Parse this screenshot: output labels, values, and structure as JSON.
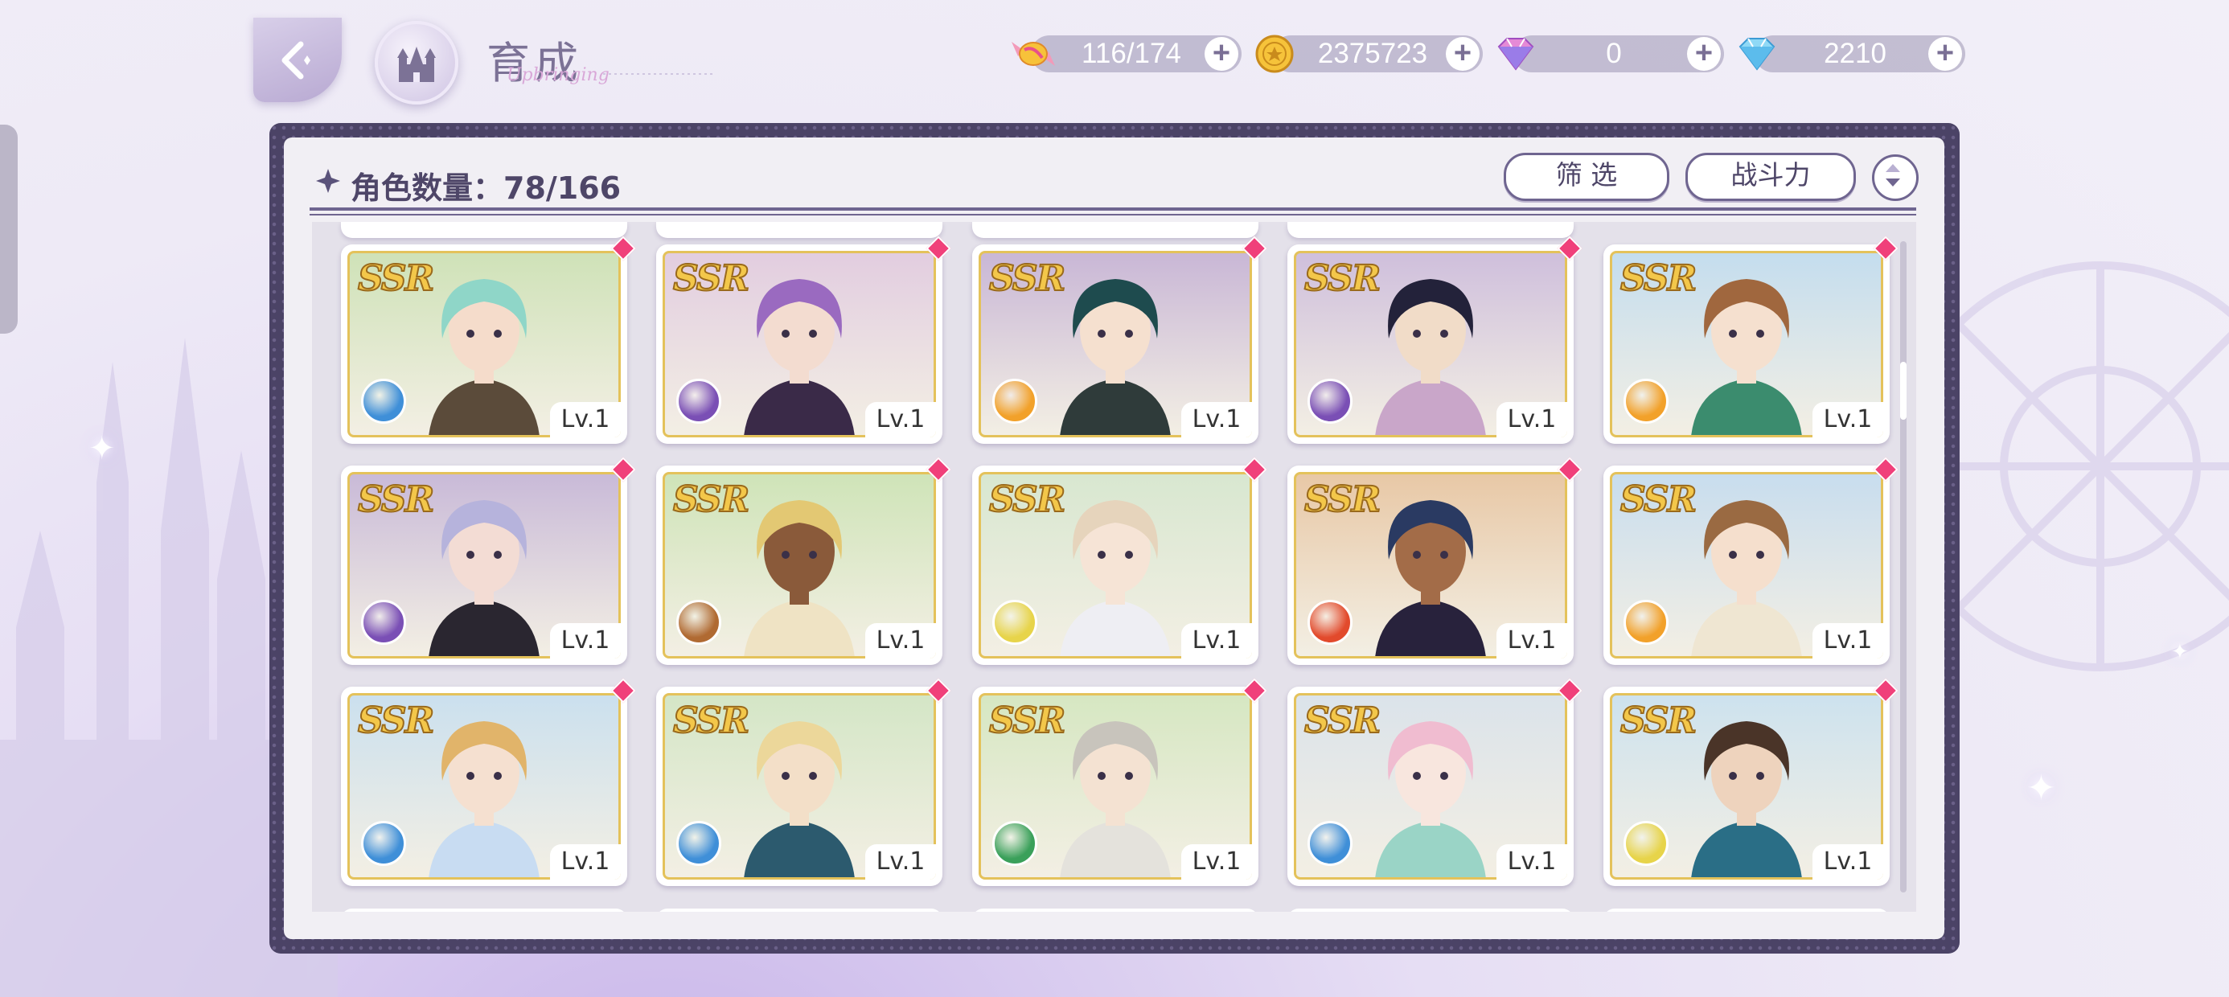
{
  "header": {
    "title": "育成",
    "title_script": "Upbringing"
  },
  "resources": [
    {
      "name": "candy-stamina",
      "value": "116/174",
      "icon": "candy-icon"
    },
    {
      "name": "gold-coin",
      "value": "2375723",
      "icon": "coin-icon"
    },
    {
      "name": "paid-gem",
      "value": "0",
      "icon": "pink-diamond-icon"
    },
    {
      "name": "free-gem",
      "value": "2210",
      "icon": "blue-diamond-icon"
    }
  ],
  "panel": {
    "count_label": "角色数量：78/166",
    "filter_label": "筛 选",
    "sort_label": "战斗力"
  },
  "cards": [
    {
      "rarity": "SSR",
      "level": "Lv.1",
      "attr_color": "#3f8fd8",
      "hair": "#8fd6c8",
      "bg": "#cfe2b8",
      "skin": "#f5dccb",
      "outfit": "#5b4b3a"
    },
    {
      "rarity": "SSR",
      "level": "Lv.1",
      "attr_color": "#7a4fb5",
      "hair": "#9a6ac0",
      "bg": "#e2cde0",
      "skin": "#f3dcd0",
      "outfit": "#3a2a48"
    },
    {
      "rarity": "SSR",
      "level": "Lv.1",
      "attr_color": "#f2a12a",
      "hair": "#1e4b4e",
      "bg": "#c9b7d6",
      "skin": "#f5e0cf",
      "outfit": "#2f3b3a"
    },
    {
      "rarity": "SSR",
      "level": "Lv.1",
      "attr_color": "#7a4fb5",
      "hair": "#23223a",
      "bg": "#cfbfdc",
      "skin": "#f1dcc8",
      "outfit": "#c9a6c9"
    },
    {
      "rarity": "SSR",
      "level": "Lv.1",
      "attr_color": "#f2a12a",
      "hair": "#a0673e",
      "bg": "#c4ddee",
      "skin": "#f5e0cf",
      "outfit": "#3b8c6e"
    },
    {
      "rarity": "SSR",
      "level": "Lv.1",
      "attr_color": "#7a4fb5",
      "hair": "#b6b3dc",
      "bg": "#c9bad8",
      "skin": "#f3dcd4",
      "outfit": "#2a2630"
    },
    {
      "rarity": "SSR",
      "level": "Lv.1",
      "attr_color": "#b06a32",
      "hair": "#e3c873",
      "bg": "#cfe4b8",
      "skin": "#8a5a3a",
      "outfit": "#efe3c4"
    },
    {
      "rarity": "SSR",
      "level": "Lv.1",
      "attr_color": "#e7d44a",
      "hair": "#e6d4bc",
      "bg": "#d8e7d0",
      "skin": "#f6e4d6",
      "outfit": "#eeeef3"
    },
    {
      "rarity": "SSR",
      "level": "Lv.1",
      "attr_color": "#e24a2c",
      "hair": "#2a3a62",
      "bg": "#e8c8a6",
      "skin": "#a36c48",
      "outfit": "#28223c"
    },
    {
      "rarity": "SSR",
      "level": "Lv.1",
      "attr_color": "#f2a12a",
      "hair": "#9a6a42",
      "bg": "#c8ddee",
      "skin": "#f5dfcd",
      "outfit": "#efe6d2"
    },
    {
      "rarity": "SSR",
      "level": "Lv.1",
      "attr_color": "#3f8fd8",
      "hair": "#e1b46a",
      "bg": "#cbe0ee",
      "skin": "#f5e0d0",
      "outfit": "#c8dcf2"
    },
    {
      "rarity": "SSR",
      "level": "Lv.1",
      "attr_color": "#3f8fd8",
      "hair": "#ecd79a",
      "bg": "#d4e6c6",
      "skin": "#f3dfc8",
      "outfit": "#2c5a6e"
    },
    {
      "rarity": "SSR",
      "level": "Lv.1",
      "attr_color": "#3aa05a",
      "hair": "#c8c4bc",
      "bg": "#d6e7c2",
      "skin": "#f4e2d2",
      "outfit": "#e4e2dc"
    },
    {
      "rarity": "SSR",
      "level": "Lv.1",
      "attr_color": "#3f8fd8",
      "hair": "#f0bcd0",
      "bg": "#dbe3ea",
      "skin": "#f8e6de",
      "outfit": "#9ad4c6"
    },
    {
      "rarity": "SSR",
      "level": "Lv.1",
      "attr_color": "#e7d44a",
      "hair": "#4a3428",
      "bg": "#cde2ee",
      "skin": "#eed3bd",
      "outfit": "#2a6e86"
    }
  ]
}
